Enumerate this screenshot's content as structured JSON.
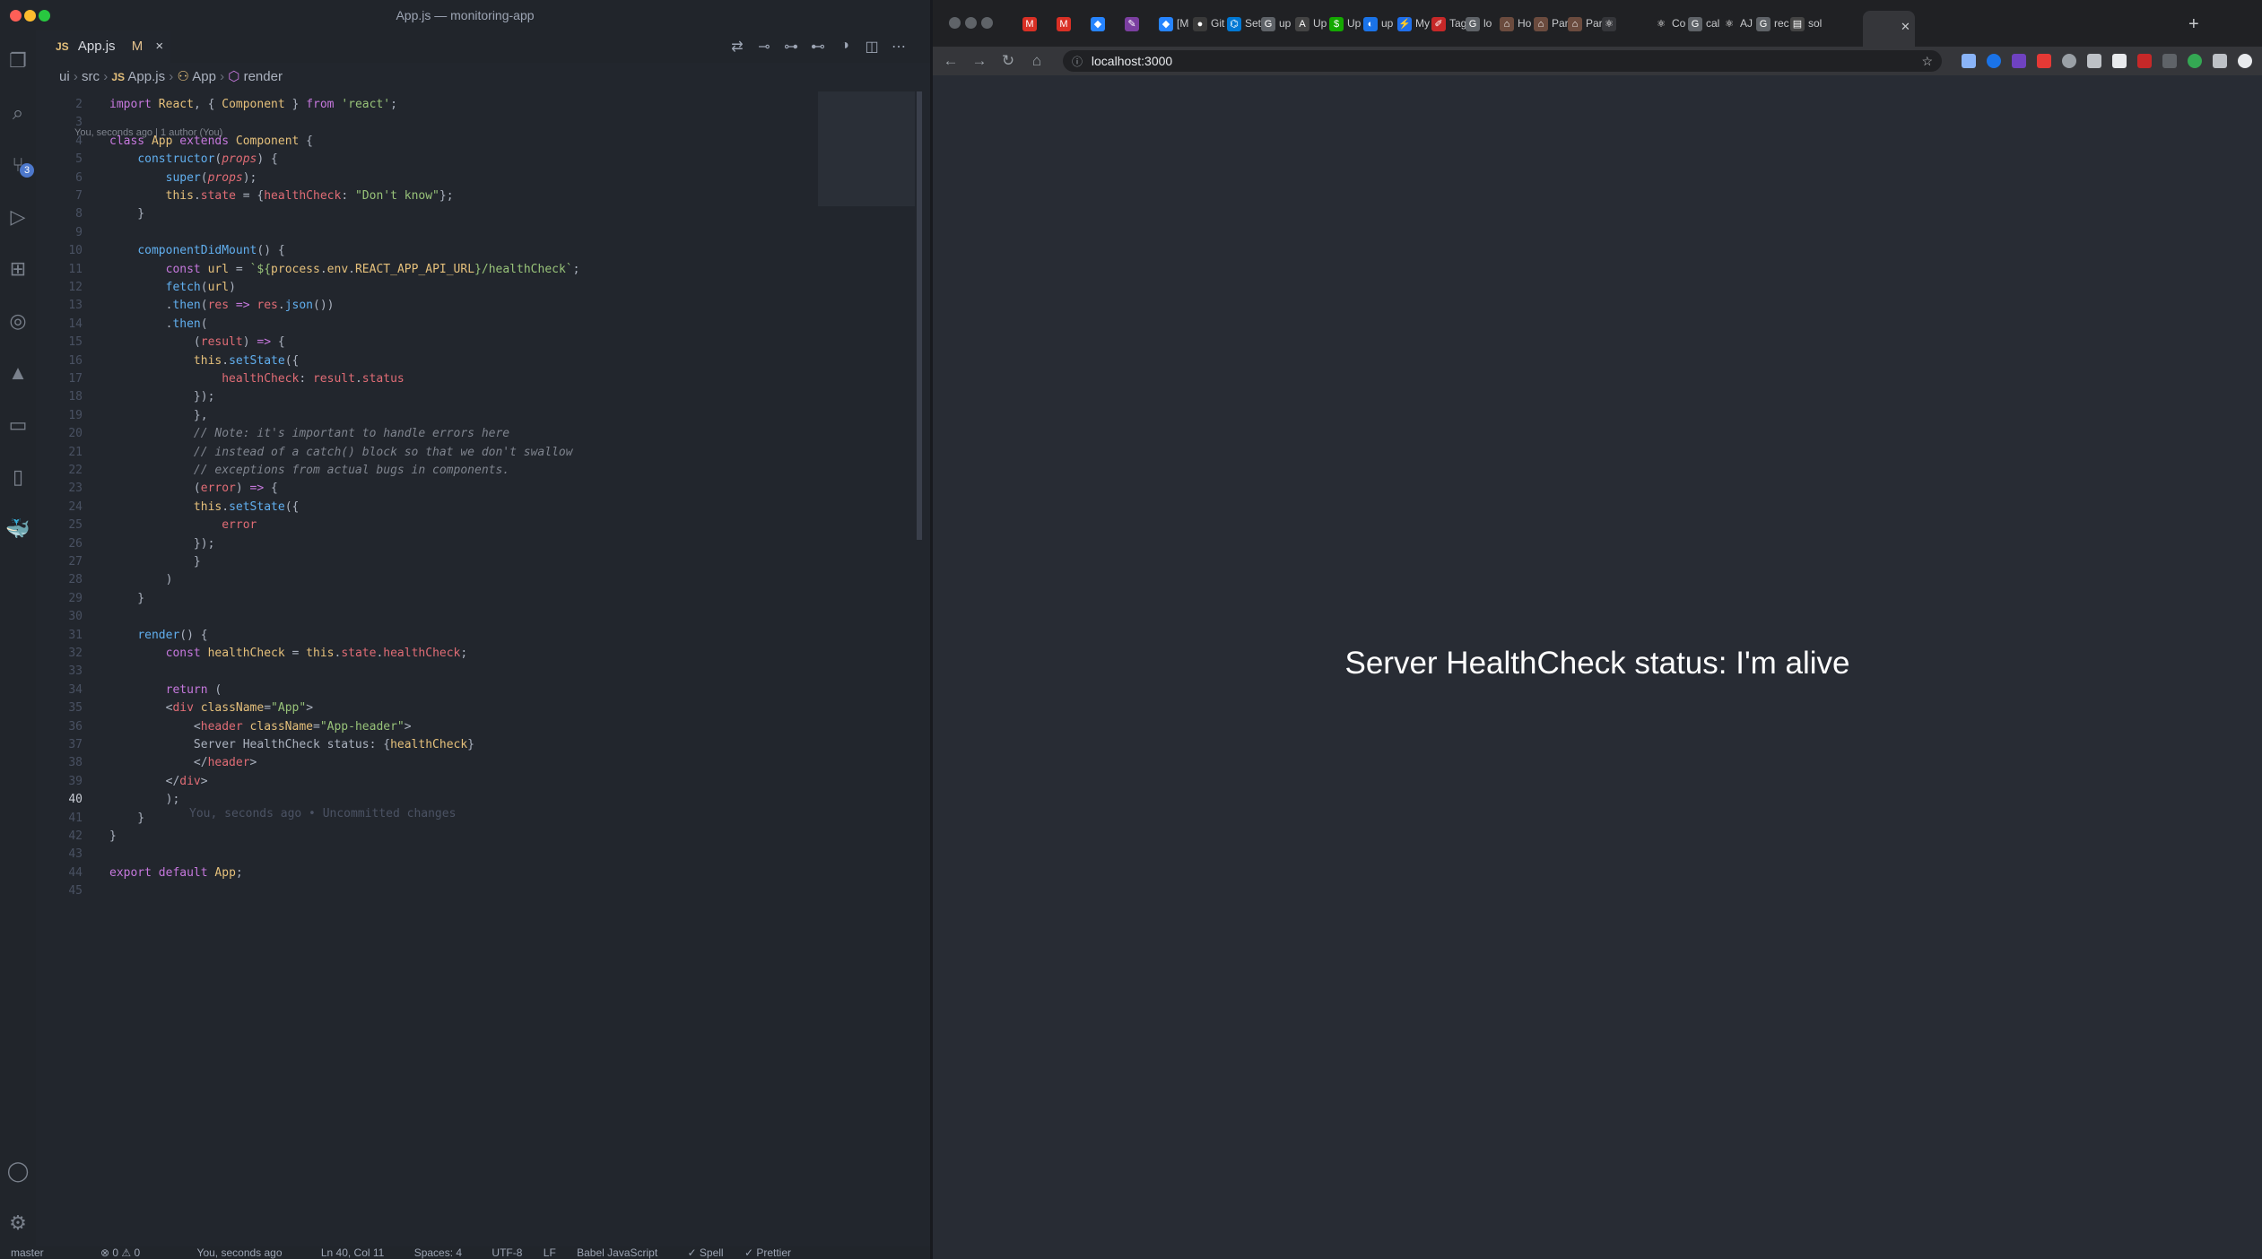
{
  "vscode": {
    "title": "App.js — monitoring-app",
    "tab": {
      "icon_label": "JS",
      "name": "App.js",
      "status": "M",
      "close": "×"
    },
    "breadcrumb": [
      "ui",
      "src",
      "App.js",
      "App",
      "render"
    ],
    "codelens": "You, seconds ago | 1 author (You)",
    "blame": "You, seconds ago • Uncommitted changes",
    "scm_badge": "3",
    "status": {
      "branch": "master",
      "problems": "⊗ 0 ⚠ 0",
      "blame": "You, seconds ago",
      "position": "Ln 40, Col 11",
      "spaces": "Spaces: 4",
      "encoding": "UTF-8",
      "eol": "LF",
      "language": "Babel JavaScript",
      "spell": "✓ Spell",
      "prettier": "✓ Prettier"
    }
  },
  "browser": {
    "url": "localhost:3000",
    "tabs": [
      {
        "label": "",
        "icon": "gmail-icon",
        "color": "#d93025",
        "glyph": "M"
      },
      {
        "label": "",
        "icon": "gmail-icon",
        "color": "#d93025",
        "glyph": "M"
      },
      {
        "label": "",
        "icon": "jira-icon",
        "color": "#2684ff",
        "glyph": "◆"
      },
      {
        "label": "",
        "icon": "app-icon",
        "color": "#7b3fa0",
        "glyph": "✎"
      },
      {
        "label": "[M",
        "icon": "jira-icon",
        "color": "#2684ff",
        "glyph": "◆"
      },
      {
        "label": "Git",
        "icon": "github-icon",
        "color": "#3a3a3a",
        "glyph": "●"
      },
      {
        "label": "Set",
        "icon": "azure-icon",
        "color": "#0078d4",
        "glyph": "⌬"
      },
      {
        "label": "up",
        "icon": "google-icon",
        "color": "#5f6368",
        "glyph": "G"
      },
      {
        "label": "Up",
        "icon": "upwork-icon",
        "color": "#444",
        "glyph": "A"
      },
      {
        "label": "Up",
        "icon": "upwork-icon",
        "color": "#14a800",
        "glyph": "$"
      },
      {
        "label": "up",
        "icon": "docs-icon",
        "color": "#1a73e8",
        "glyph": "◐"
      },
      {
        "label": "My",
        "icon": "cloud-icon",
        "color": "#1f6feb",
        "glyph": "⚡"
      },
      {
        "label": "Tag",
        "icon": "pen-icon",
        "color": "#c62828",
        "glyph": "✐"
      },
      {
        "label": "lo",
        "icon": "google-icon",
        "color": "#5f6368",
        "glyph": "G"
      },
      {
        "label": "Ho",
        "icon": "house-icon",
        "color": "#6b4b3e",
        "glyph": "⌂"
      },
      {
        "label": "Par",
        "icon": "house-icon",
        "color": "#6b4b3e",
        "glyph": "⌂"
      },
      {
        "label": "Par",
        "icon": "house-icon",
        "color": "#6b4b3e",
        "glyph": "⌂"
      },
      {
        "label": "",
        "icon": "react-icon",
        "color": "#35363a",
        "glyph": "⚛",
        "active": true
      },
      {
        "label": "Co",
        "icon": "react-icon",
        "color": "#202124",
        "glyph": "⚛"
      },
      {
        "label": "cal",
        "icon": "google-icon",
        "color": "#5f6368",
        "glyph": "G"
      },
      {
        "label": "AJ",
        "icon": "react-icon",
        "color": "#202124",
        "glyph": "⚛"
      },
      {
        "label": "rec",
        "icon": "google-icon",
        "color": "#5f6368",
        "glyph": "G"
      },
      {
        "label": "sol",
        "icon": "stackoverflow-icon",
        "color": "#444",
        "glyph": "▤"
      }
    ],
    "content": "Server HealthCheck status: I'm alive"
  },
  "code": [
    {
      "n": "2",
      "h": "<span class=\"k\">import</span> <span class=\"c\">React</span>, { <span class=\"c\">Component</span> } <span class=\"k\">from</span> <span class=\"s\">'react'</span>;"
    },
    {
      "n": "3",
      "h": ""
    },
    {
      "n": "4",
      "h": "<span class=\"k\">class</span> <span class=\"c\">App</span> <span class=\"k\">extends</span> <span class=\"c\">Component</span> {"
    },
    {
      "n": "5",
      "h": "    <span class=\"f\">constructor</span>(<span class=\"p\" style=\"font-style:italic\">props</span>) {"
    },
    {
      "n": "6",
      "h": "        <span class=\"f\">super</span>(<span class=\"p\" style=\"font-style:italic\">props</span>);"
    },
    {
      "n": "7",
      "h": "        <span class=\"c\">this</span>.<span class=\"p\">state</span> = {<span class=\"p\">healthCheck</span>: <span class=\"s\">\"Don't know\"</span>};"
    },
    {
      "n": "8",
      "h": "    }"
    },
    {
      "n": "9",
      "h": ""
    },
    {
      "n": "10",
      "h": "    <span class=\"f\">componentDidMount</span>() {"
    },
    {
      "n": "11",
      "h": "        <span class=\"k\">const</span> <span class=\"c\">url</span> = <span class=\"s\">`${</span><span class=\"c\">process</span>.<span class=\"c\">env</span>.<span class=\"c\">REACT_APP_API_URL</span><span class=\"s\">}/healthCheck`</span>;"
    },
    {
      "n": "12",
      "h": "        <span class=\"f\">fetch</span>(<span class=\"c\">url</span>)"
    },
    {
      "n": "13",
      "h": "        .<span class=\"f\">then</span>(<span class=\"p\">res</span> <span class=\"k\">=&gt;</span> <span class=\"p\">res</span>.<span class=\"f\">json</span>())"
    },
    {
      "n": "14",
      "h": "        .<span class=\"f\">then</span>("
    },
    {
      "n": "15",
      "h": "            (<span class=\"p\">result</span>) <span class=\"k\">=&gt;</span> {"
    },
    {
      "n": "16",
      "h": "            <span class=\"c\">this</span>.<span class=\"f\">setState</span>({"
    },
    {
      "n": "17",
      "h": "                <span class=\"p\">healthCheck</span>: <span class=\"p\">result</span>.<span class=\"p\">status</span>"
    },
    {
      "n": "18",
      "h": "            });"
    },
    {
      "n": "19",
      "h": "            },"
    },
    {
      "n": "20",
      "h": "            <span class=\"cm\">// Note: it's important to handle errors here</span>"
    },
    {
      "n": "21",
      "h": "            <span class=\"cm\">// instead of a catch() block so that we don't swallow</span>"
    },
    {
      "n": "22",
      "h": "            <span class=\"cm\">// exceptions from actual bugs in components.</span>"
    },
    {
      "n": "23",
      "h": "            (<span class=\"p\">error</span>) <span class=\"k\">=&gt;</span> {"
    },
    {
      "n": "24",
      "h": "            <span class=\"c\">this</span>.<span class=\"f\">setState</span>({"
    },
    {
      "n": "25",
      "h": "                <span class=\"p\">error</span>"
    },
    {
      "n": "26",
      "h": "            });"
    },
    {
      "n": "27",
      "h": "            }"
    },
    {
      "n": "28",
      "h": "        )"
    },
    {
      "n": "29",
      "h": "    }"
    },
    {
      "n": "30",
      "h": ""
    },
    {
      "n": "31",
      "h": "    <span class=\"f\">render</span>() {"
    },
    {
      "n": "32",
      "h": "        <span class=\"k\">const</span> <span class=\"c\">healthCheck</span> = <span class=\"c\">this</span>.<span class=\"p\">state</span>.<span class=\"p\">healthCheck</span>;"
    },
    {
      "n": "33",
      "h": ""
    },
    {
      "n": "34",
      "h": "        <span class=\"k\">return</span> ("
    },
    {
      "n": "35",
      "h": "        &lt;<span class=\"p\">div</span> <span class=\"c\">className</span>=<span class=\"s\">\"App\"</span>&gt;"
    },
    {
      "n": "36",
      "h": "            &lt;<span class=\"p\">header</span> <span class=\"c\">className</span>=<span class=\"s\">\"App-header\"</span>&gt;"
    },
    {
      "n": "37",
      "h": "            Server HealthCheck status: {<span class=\"c\">healthCheck</span>}"
    },
    {
      "n": "38",
      "h": "            &lt;/<span class=\"p\">header</span>&gt;"
    },
    {
      "n": "39",
      "h": "        &lt;/<span class=\"p\">div</span>&gt;"
    },
    {
      "n": "40",
      "h": "        );",
      "cur": true
    },
    {
      "n": "41",
      "h": "    }"
    },
    {
      "n": "42",
      "h": "}"
    },
    {
      "n": "43",
      "h": ""
    },
    {
      "n": "44",
      "h": "<span class=\"k\">export</span> <span class=\"k\">default</span> <span class=\"c\">App</span>;"
    },
    {
      "n": "45",
      "h": ""
    }
  ]
}
